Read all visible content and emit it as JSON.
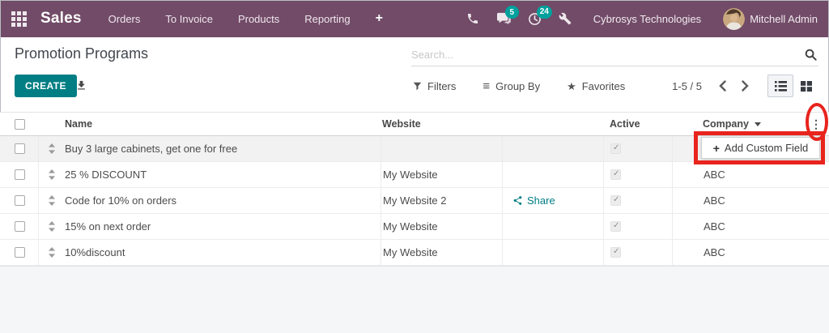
{
  "navbar": {
    "app_name": "Sales",
    "menu_items": [
      "Orders",
      "To Invoice",
      "Products",
      "Reporting"
    ],
    "plus_button": "+",
    "messages_badge": "5",
    "activities_badge": "24",
    "company_name": "Cybrosys Technologies",
    "user_name": "Mitchell Admin",
    "colors": {
      "background": "#714B67",
      "badge": "#00A09D"
    }
  },
  "control_panel": {
    "title": "Promotion Programs",
    "create_button": "CREATE",
    "search_placeholder": "Search...",
    "filters": "Filters",
    "group_by": "Group By",
    "favorites": "Favorites",
    "pager": "1-5 / 5"
  },
  "table": {
    "columns": {
      "name": "Name",
      "website": "Website",
      "active": "Active",
      "company": "Company"
    },
    "share_label": "Share",
    "rows": [
      {
        "name": "Buy 3 large cabinets, get one for free",
        "website": "",
        "active": true,
        "company": ""
      },
      {
        "name": "25 % DISCOUNT",
        "website": "My Website",
        "active": true,
        "company": "ABC"
      },
      {
        "name": "Code for 10% on orders",
        "website": "My Website 2",
        "active": true,
        "company": "ABC"
      },
      {
        "name": "15% on next order",
        "website": "My Website",
        "active": true,
        "company": "ABC"
      },
      {
        "name": "10%discount",
        "website": "My Website",
        "active": true,
        "company": "ABC"
      }
    ]
  },
  "dropdown": {
    "plus_icon": "+",
    "label": "Add Custom Field"
  },
  "annotations": {
    "highlight_color": "#E8241D"
  },
  "theme": {
    "accent_teal": "#017E84"
  }
}
